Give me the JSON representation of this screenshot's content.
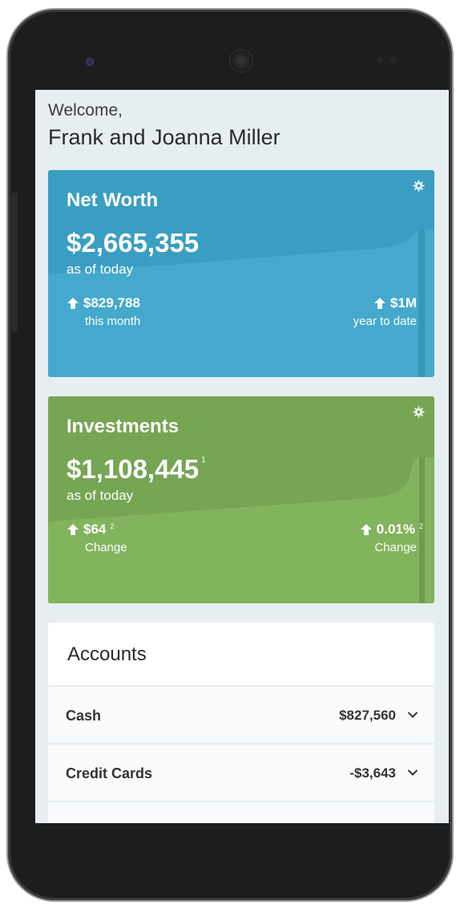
{
  "header": {
    "welcome": "Welcome,",
    "user_name": "Frank and Joanna Miller"
  },
  "net_worth": {
    "title": "Net Worth",
    "amount": "$2,665,355",
    "as_of": "as of today",
    "month_change": "$829,788",
    "month_label": "this month",
    "ytd_change": "$1M",
    "ytd_label": "year to date",
    "color": "#3a9ec2",
    "icon": "gear-icon"
  },
  "investments": {
    "title": "Investments",
    "amount": "$1,108,445",
    "amount_footnote": "1",
    "as_of": "as of today",
    "change_value": "$64",
    "change_value_footnote": "2",
    "change_label": "Change",
    "change_pct": "0.01%",
    "change_pct_footnote": "2",
    "change_pct_label": "Change",
    "color": "#76a553",
    "icon": "gear-icon"
  },
  "accounts": {
    "title": "Accounts",
    "rows": [
      {
        "name": "Cash",
        "value": "$827,560",
        "icon": "chevron-down-icon"
      },
      {
        "name": "Credit Cards",
        "value": "-$3,643",
        "icon": "chevron-down-icon"
      }
    ]
  }
}
